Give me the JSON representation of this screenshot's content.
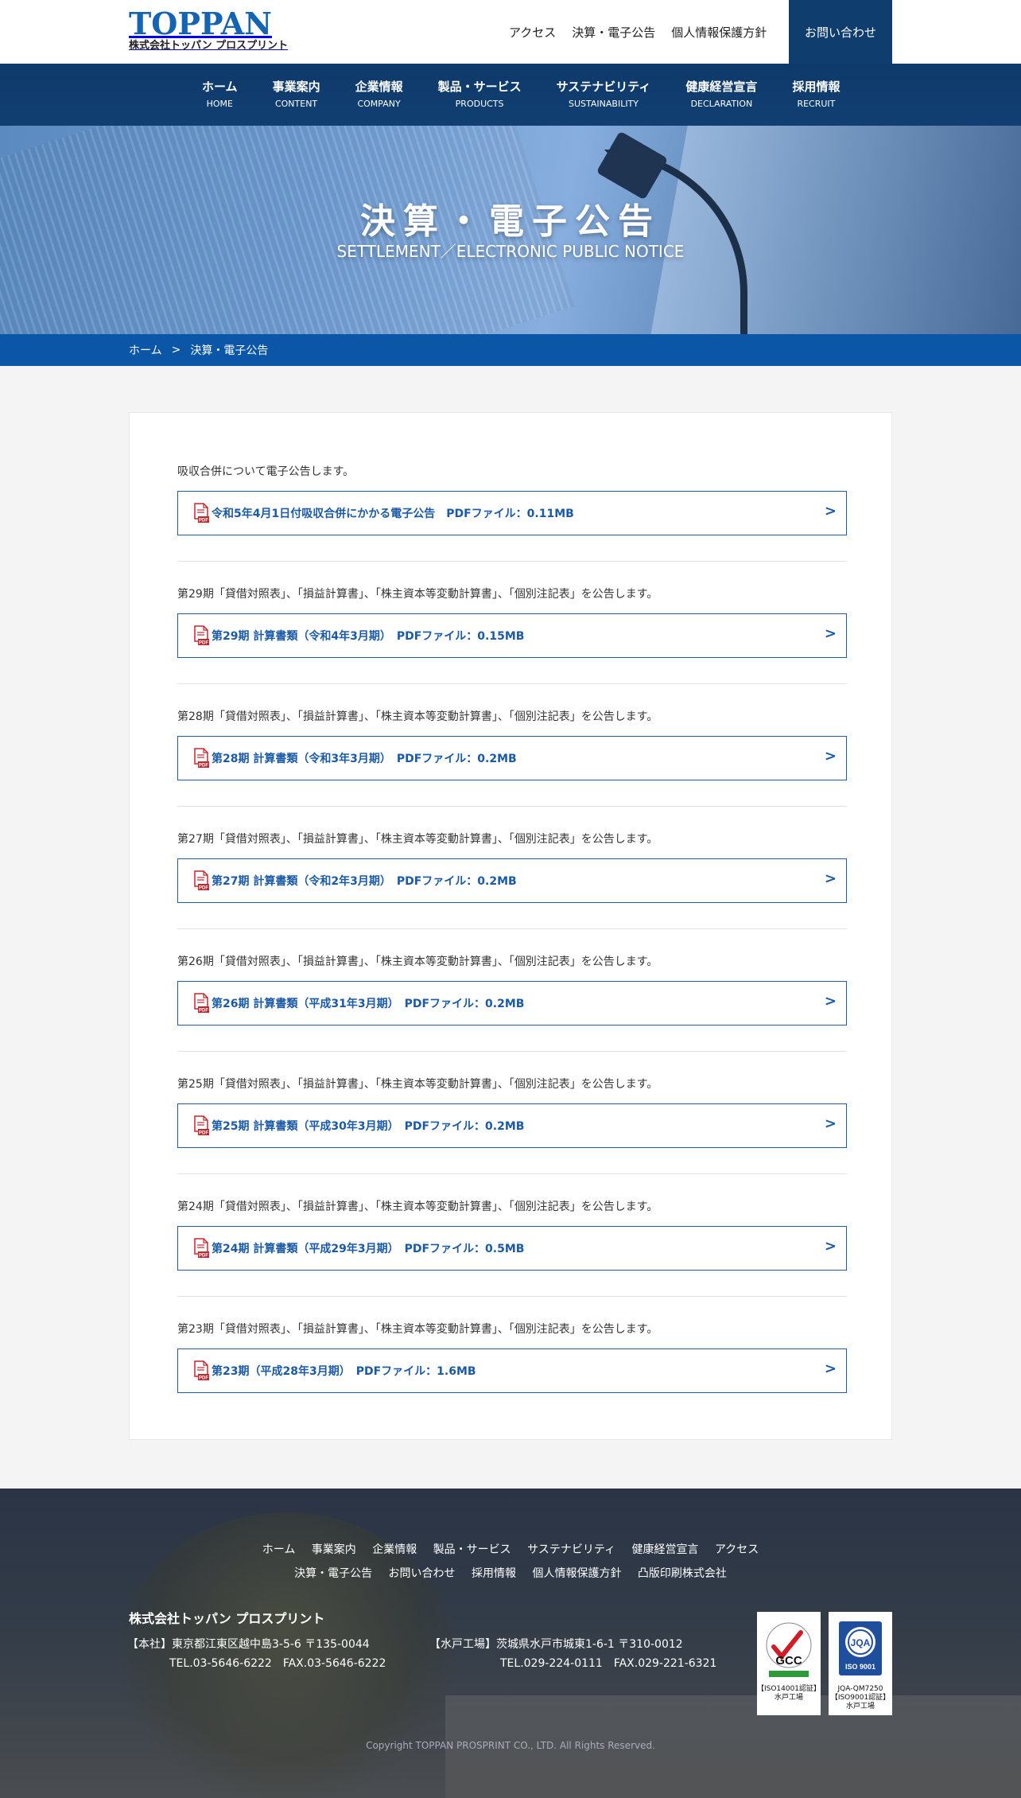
{
  "header": {
    "logo_main": "TOPPAN",
    "logo_sub": "株式会社トッパン プロスプリント",
    "top_links": [
      "アクセス",
      "決算・電子公告",
      "個人情報保護方針"
    ],
    "contact_label": "お問い合わせ"
  },
  "nav": {
    "items": [
      {
        "jp": "ホーム",
        "en": "HOME"
      },
      {
        "jp": "事業案内",
        "en": "CONTENT"
      },
      {
        "jp": "企業情報",
        "en": "COMPANY"
      },
      {
        "jp": "製品・サービス",
        "en": "PRODUCTS"
      },
      {
        "jp": "サステナビリティ",
        "en": "SUSTAINABILITY"
      },
      {
        "jp": "健康経営宣言",
        "en": "DECLARATION"
      },
      {
        "jp": "採用情報",
        "en": "RECRUIT"
      }
    ]
  },
  "hero": {
    "title": "決算・電子公告",
    "subtitle": "SETTLEMENT／ELECTRONIC PUBLIC NOTICE"
  },
  "breadcrumb": {
    "home": "ホーム",
    "sep": ">",
    "current": "決算・電子公告"
  },
  "notices": [
    {
      "text": "吸収合併について電子公告します。",
      "link": "令和5年4月1日付吸収合併にかかる電子公告　PDFファイル：0.11MB"
    },
    {
      "text": "第29期「貸借対照表」、「損益計算書」、「株主資本等変動計算書」、「個別注記表」を公告します。",
      "link": "第29期 計算書類（令和4年3月期）　PDFファイル：0.15MB"
    },
    {
      "text": "第28期「貸借対照表」、「損益計算書」、「株主資本等変動計算書」、「個別注記表」を公告します。",
      "link": "第28期 計算書類（令和3年3月期）　PDFファイル：0.2MB"
    },
    {
      "text": "第27期「貸借対照表」、「損益計算書」、「株主資本等変動計算書」、「個別注記表」を公告します。",
      "link": "第27期 計算書類（令和2年3月期）　PDFファイル：0.2MB"
    },
    {
      "text": "第26期「貸借対照表」、「損益計算書」、「株主資本等変動計算書」、「個別注記表」を公告します。",
      "link": "第26期 計算書類（平成31年3月期）　PDFファイル：0.2MB"
    },
    {
      "text": "第25期「貸借対照表」、「損益計算書」、「株主資本等変動計算書」、「個別注記表」を公告します。",
      "link": "第25期 計算書類（平成30年3月期）　PDFファイル：0.2MB"
    },
    {
      "text": "第24期「貸借対照表」、「損益計算書」、「株主資本等変動計算書」、「個別注記表」を公告します。",
      "link": "第24期 計算書類（平成29年3月期）　PDFファイル：0.5MB"
    },
    {
      "text": "第23期「貸借対照表」、「損益計算書」、「株主資本等変動計算書」、「個別注記表」を公告します。",
      "link": "第23期（平成28年3月期）　PDFファイル：1.6MB"
    }
  ],
  "link_arrow": ">",
  "pdf_icon_label": "PDF",
  "footer": {
    "nav_row1": [
      "ホーム",
      "事業案内",
      "企業情報",
      "製品・サービス",
      "サステナビリティ",
      "健康経営宣言",
      "アクセス"
    ],
    "nav_row2": [
      "決算・電子公告",
      "お問い合わせ",
      "採用情報",
      "個人情報保護方針",
      "凸版印刷株式会社"
    ],
    "company_name": "株式会社トッパン プロスプリント",
    "hq_line1": "【本社】東京都江東区越中島3-5-6 〒135-0044",
    "hq_line2": "TEL.03-5646-6222　FAX.03-5646-6222",
    "plant_line1": "【水戸工場】茨城県水戸市城東1-6-1 〒310-0012",
    "plant_line2": "TEL.029-224-0111　FAX.029-221-6321",
    "cert1_line1": "【ISO14001認証】",
    "cert1_line2": "水戸工場",
    "cert1_mark": "GCC",
    "cert2_line1": "JQA-QM7250",
    "cert2_line2": "【ISO9001認証】",
    "cert2_line3": "水戸工場",
    "cert2_mark": "JQA",
    "cert2_iso": "ISO 9001",
    "copyright": "Copyright TOPPAN PROSPRINT CO., LTD. All Rights Reserved."
  },
  "colors": {
    "brand_blue": "#1464b4",
    "nav_bg": "#0f3d6e",
    "breadcrumb_bg": "#0b56a6",
    "link_blue": "#1b5aa6",
    "pdf_red": "#c8232c"
  }
}
